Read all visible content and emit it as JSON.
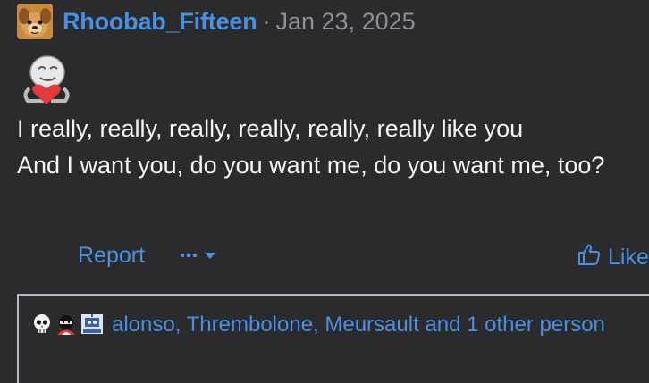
{
  "post": {
    "username": "Rhoobab_Fifteen",
    "separator": "·",
    "date": "Jan 23, 2025",
    "body_lines": [
      "I really, really, really, really, really, really like you",
      "And I want you, do you want me, do you want me, too?"
    ],
    "avatar_icon": "dog-avatar-icon",
    "sticker_icon": "heart-hug-sticker-icon"
  },
  "actions": {
    "report_label": "Report",
    "more_icon": "ellipsis-icon",
    "dropdown_icon": "chevron-down-icon",
    "like_label": "Like",
    "like_icon": "thumbs-up-icon"
  },
  "reactions": {
    "icons": [
      "skull-icon",
      "ninja-icon",
      "robot-icon"
    ],
    "text": "alonso, Thrembolone, Meursault and 1 other person"
  },
  "colors": {
    "background": "#2b2b2d",
    "accent": "#4a90e2",
    "text": "#f5f5f5",
    "muted": "#8e8e93"
  }
}
